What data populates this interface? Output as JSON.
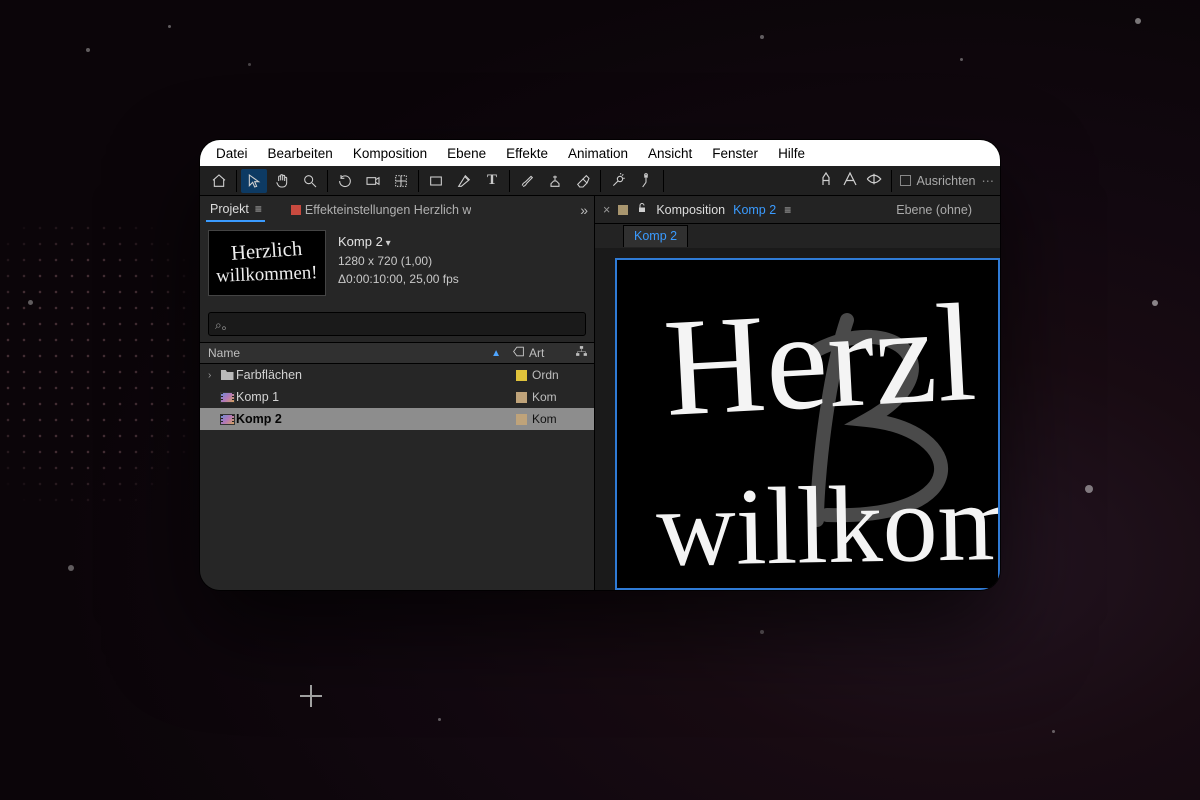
{
  "menu": {
    "items": [
      "Datei",
      "Bearbeiten",
      "Komposition",
      "Ebene",
      "Effekte",
      "Animation",
      "Ansicht",
      "Fenster",
      "Hilfe"
    ]
  },
  "toolbar": {
    "align_label": "Ausrichten"
  },
  "project_panel": {
    "tab_label": "Projekt",
    "effect_settings_label": "Effekteinstellungen Herzlich w",
    "comp": {
      "name": "Komp 2",
      "dims": "1280 x 720 (1,00)",
      "duration": "Δ0:00:10:00, 25,00 fps",
      "text_line1": "Herzlich",
      "text_line2": "willkommen!"
    },
    "search_placeholder": "",
    "columns": {
      "name": "Name",
      "type": "Art"
    },
    "items": [
      {
        "name": "Farbflächen",
        "type": "Ordn",
        "kind": "folder",
        "color": "#e0c33b",
        "expandable": true
      },
      {
        "name": "Komp 1",
        "type": "Kom",
        "kind": "comp",
        "color": "#bfa37a",
        "expandable": false
      },
      {
        "name": "Komp 2",
        "type": "Kom",
        "kind": "comp",
        "color": "#bfa37a",
        "expandable": false,
        "selected": true
      }
    ]
  },
  "viewer_panel": {
    "tab_prefix": "Komposition",
    "tab_name": "Komp 2",
    "layer_tab": "Ebene  (ohne)",
    "chip": "Komp 2",
    "canvas_line1": "Herzl",
    "canvas_line2": "willkom"
  }
}
